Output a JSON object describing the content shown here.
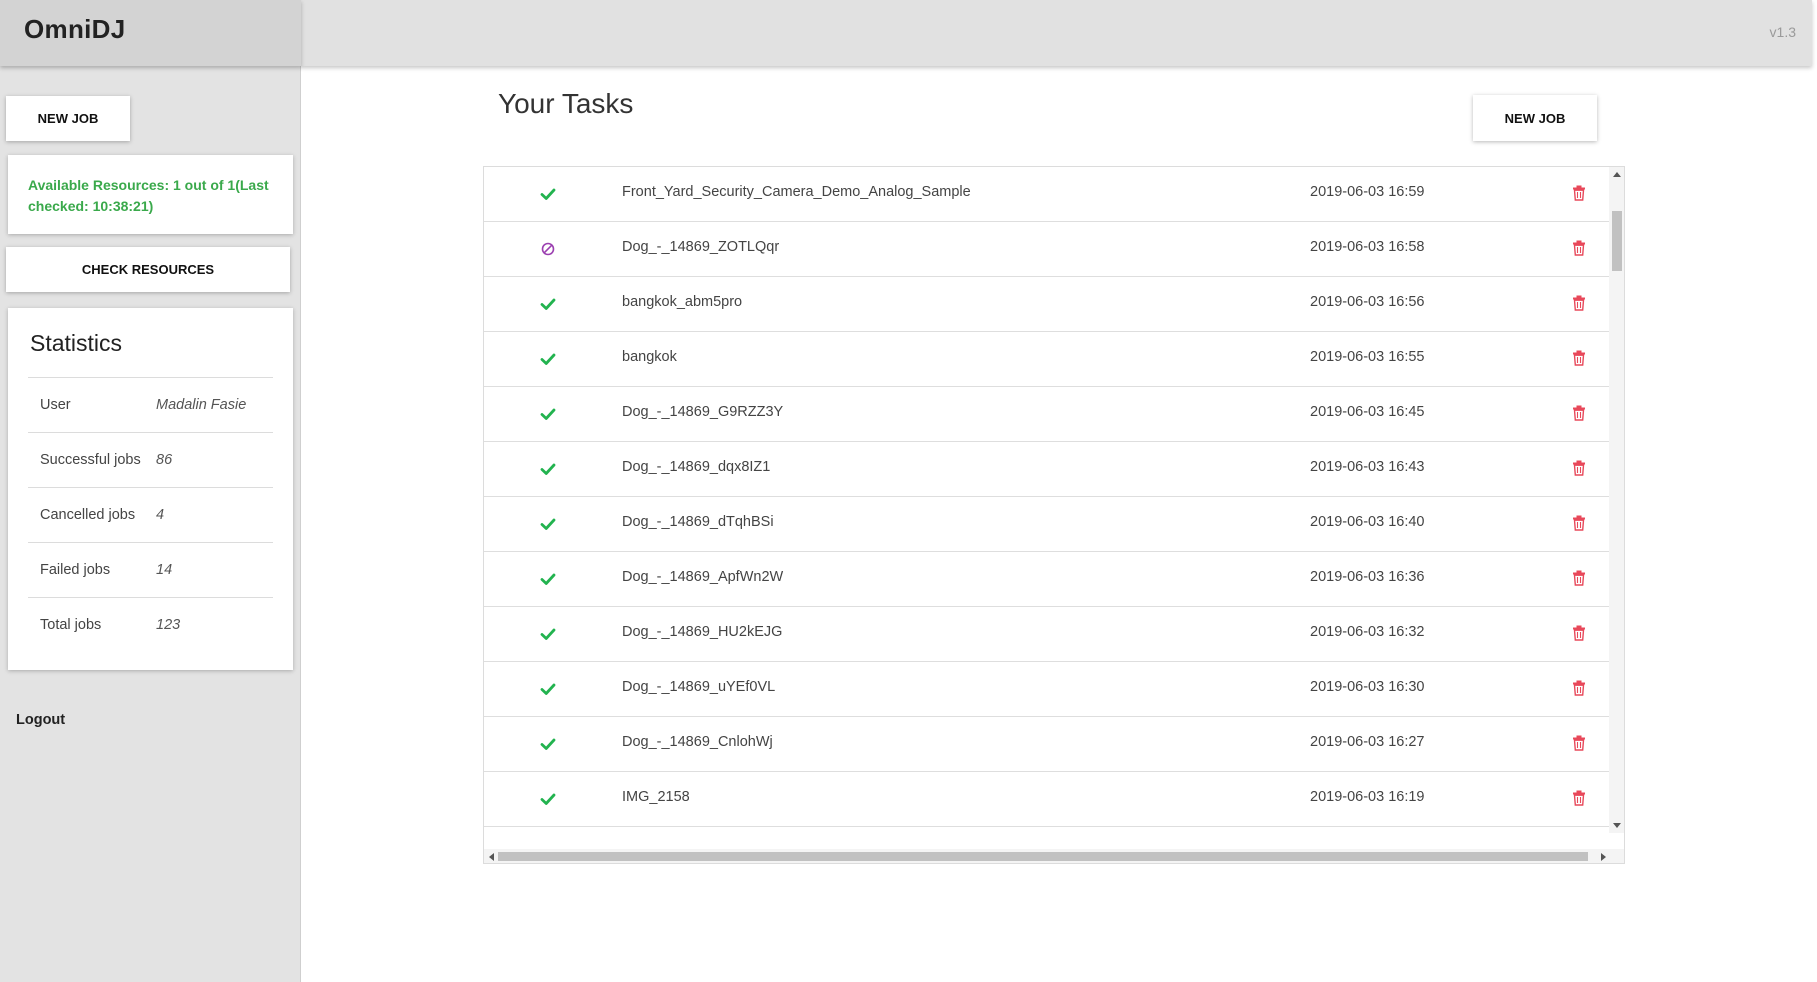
{
  "app": {
    "title": "OmniDJ",
    "version": "v1.3"
  },
  "sidebar": {
    "new_job_label": "NEW JOB",
    "resources_text": "Available Resources: 1 out of 1(Last checked: 10:38:21)",
    "check_resources_label": "CHECK RESOURCES",
    "logout_label": "Logout",
    "statistics": {
      "title": "Statistics",
      "rows": [
        {
          "label": "User",
          "value": "Madalin Fasie"
        },
        {
          "label": "Successful jobs",
          "value": "86"
        },
        {
          "label": "Cancelled jobs",
          "value": "4"
        },
        {
          "label": "Failed jobs",
          "value": "14"
        },
        {
          "label": "Total jobs",
          "value": "123"
        }
      ]
    }
  },
  "main": {
    "title": "Your Tasks",
    "new_job_label": "NEW JOB",
    "tasks": [
      {
        "status": "success",
        "name": "Front_Yard_Security_Camera_Demo_Analog_Sample",
        "date": "2019-06-03 16:59"
      },
      {
        "status": "cancelled",
        "name": "Dog_-_14869_ZOTLQqr",
        "date": "2019-06-03 16:58"
      },
      {
        "status": "success",
        "name": "bangkok_abm5pro",
        "date": "2019-06-03 16:56"
      },
      {
        "status": "success",
        "name": "bangkok",
        "date": "2019-06-03 16:55"
      },
      {
        "status": "success",
        "name": "Dog_-_14869_G9RZZ3Y",
        "date": "2019-06-03 16:45"
      },
      {
        "status": "success",
        "name": "Dog_-_14869_dqx8IZ1",
        "date": "2019-06-03 16:43"
      },
      {
        "status": "success",
        "name": "Dog_-_14869_dTqhBSi",
        "date": "2019-06-03 16:40"
      },
      {
        "status": "success",
        "name": "Dog_-_14869_ApfWn2W",
        "date": "2019-06-03 16:36"
      },
      {
        "status": "success",
        "name": "Dog_-_14869_HU2kEJG",
        "date": "2019-06-03 16:32"
      },
      {
        "status": "success",
        "name": "Dog_-_14869_uYEf0VL",
        "date": "2019-06-03 16:30"
      },
      {
        "status": "success",
        "name": "Dog_-_14869_CnlohWj",
        "date": "2019-06-03 16:27"
      },
      {
        "status": "success",
        "name": "IMG_2158",
        "date": "2019-06-03 16:19"
      }
    ]
  },
  "colors": {
    "success": "#22b34f",
    "cancelled": "#9b3fb0",
    "delete": "#e8485a",
    "resources_text": "#3aa94b"
  },
  "icons": {
    "success": "check-icon",
    "cancelled": "cancel-icon",
    "delete": "trash-icon"
  }
}
